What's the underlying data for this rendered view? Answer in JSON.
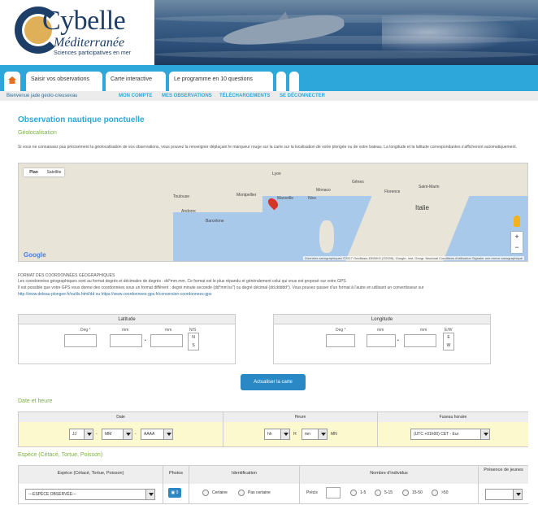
{
  "header": {
    "logo_title": "Cybelle",
    "logo_sub": "Méditerranée",
    "logo_tag": "Sciences participatives en mer"
  },
  "nav": {
    "tabs": [
      {
        "label": "Saisir vos observations"
      },
      {
        "label": "Carte interactive"
      },
      {
        "label": "Le programme en 10 questions"
      }
    ]
  },
  "subnav": {
    "welcome": "Bienvenue jade geolo-creusevau",
    "links": [
      "MON COMPTE",
      "MES OBSERVATIONS",
      "TÉLÉCHARGEMENTS",
      "SE DÉCONNECTER"
    ]
  },
  "page": {
    "title": "Observation nautique ponctuelle",
    "geoloc_heading": "Géolocalisation",
    "geoloc_text": "Si vous ne connaissez pas précisément la géolocalisation de vos observations, vous pouvez la renseigner déplaçant le marqueur rouge sur la carte sur la localisation de votre plongée ou de votre bateau. La longitude et la latitude correspondantes s'afficheront automatiquement.",
    "format_heading": "FORMAT DES COORDONNÉES GÉOGRAPHIQUES",
    "format_text1": "Les coordonnées géographiques sont au format degrés et décimales de degrés : dd°mm.mm. Ce format est le plus répandu et généralement celui qui vous est proposé sur votre GPS.",
    "format_text2": "Il est possible que votre GPS vous donne des coordonnées sous un format différent : degré minute seconde (dd°mm'ss'') ou degré décimal (dd.ddddd°). Vous pouvez passer d'un format à l'autre en utilisant un convertisseur sur",
    "format_link": "http://www.deleau-plongee.fr/outils.html/dd ou https://www.coordonnees-gps.fr/conversion-coordonnees-gps"
  },
  "map": {
    "mode_plan": "Plan",
    "mode_sat": "Satellite",
    "labels": [
      "Toulouse",
      "Montpellier",
      "Marseille",
      "Monaco",
      "Nice",
      "Gênes",
      "Florence",
      "Italie",
      "Andorre",
      "Barcelone",
      "Saint-Marin",
      "Lyon"
    ],
    "country_label": "Italie",
    "copyright": "Données cartographiques ©2017 GeoBasis-DE/BKG (©2009), Google, Inst. Geogr. Nacional   Conditions d'utilisation   Signaler une erreur cartographique",
    "google": "Google",
    "zoom_in": "+",
    "zoom_out": "−"
  },
  "latitude": {
    "header": "Latitude",
    "deg": "Deg °",
    "mm1": "mm",
    "mm2": "mm",
    "hemi": "N/S",
    "n": "N",
    "s": "S"
  },
  "longitude": {
    "header": "Longitude",
    "deg": "Deg °",
    "mm1": "mm",
    "mm2": "mm",
    "hemi": "E/W",
    "e": "E",
    "w": "W"
  },
  "update_button": "Actualiser la carte",
  "datetime": {
    "heading": "Date et heure",
    "date_header": "Date",
    "time_header": "Heure",
    "tz_header": "Fuseau horaire",
    "day": "JJ",
    "month": "MM",
    "year": "AAAA",
    "hour": "hh",
    "minute": "mn",
    "h_sep": "H",
    "mn_sep": "MN",
    "tz": "(UTC +01h00) CET - Eur"
  },
  "species": {
    "heading": "Espèce (Cétacé, Tortue, Poisson)",
    "col_species": "Espèce (Cétacé, Tortue, Poisson)",
    "col_photos": "Photos",
    "col_ident": "Identification",
    "col_count": "Nombre d'individus",
    "col_young": "Présence de jeunes",
    "species_select": "---ESPÈCE OBSERVÉE---",
    "photo_count": "0",
    "ident_certain": "Certaine",
    "ident_unsure": "Pas certaine",
    "precise_label": "Précis",
    "ranges": [
      "1-5",
      "5-15",
      "15-50",
      ">50"
    ]
  }
}
